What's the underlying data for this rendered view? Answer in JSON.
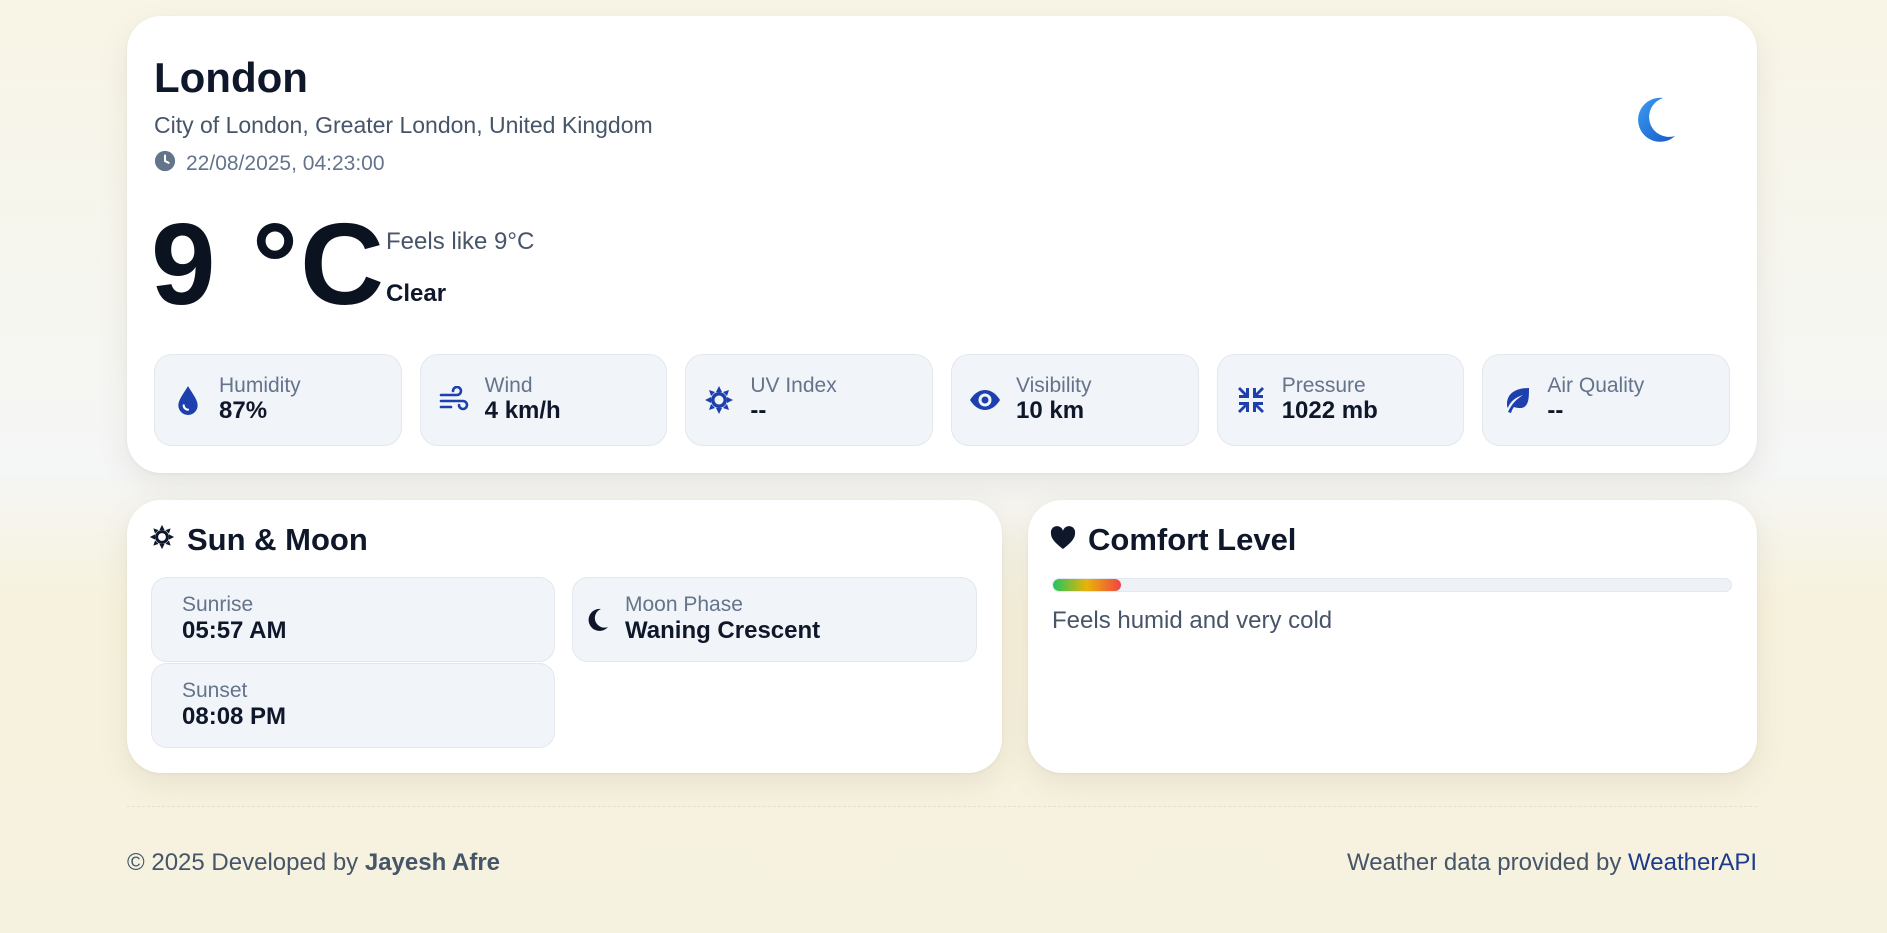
{
  "location": {
    "city": "London",
    "region": "City of London, Greater London, United Kingdom",
    "datetime": "22/08/2025, 04:23:00",
    "condition_icon": "crescent-moon-icon"
  },
  "current": {
    "temperature": "9 °C",
    "feels_like": "Feels like 9°C",
    "condition": "Clear"
  },
  "metrics": [
    {
      "label": "Humidity",
      "value": "87%",
      "icon": "droplet-icon"
    },
    {
      "label": "Wind",
      "value": "4 km/h",
      "icon": "wind-icon"
    },
    {
      "label": "UV Index",
      "value": "--",
      "icon": "sun-icon"
    },
    {
      "label": "Visibility",
      "value": "10 km",
      "icon": "eye-icon"
    },
    {
      "label": "Pressure",
      "value": "1022 mb",
      "icon": "compress-icon"
    },
    {
      "label": "Air Quality",
      "value": "--",
      "icon": "leaf-icon"
    }
  ],
  "sun_moon": {
    "title": "Sun & Moon",
    "sunrise": {
      "label": "Sunrise",
      "value": "05:57 AM"
    },
    "sunset": {
      "label": "Sunset",
      "value": "08:08 PM"
    },
    "moon_phase": {
      "label": "Moon Phase",
      "value": "Waning Crescent"
    }
  },
  "comfort": {
    "title": "Comfort Level",
    "level_fraction": 0.1,
    "description": "Feels humid and very cold"
  },
  "footer": {
    "copyright": "© 2025 Developed by ",
    "author": "Jayesh Afre",
    "credit": "Weather data provided by ",
    "provider": "WeatherAPI"
  },
  "colors": {
    "accent": "#1e40af",
    "moon_icon": "#1d6fd8",
    "text_dark": "#0f172a",
    "text_muted": "#64748b"
  }
}
